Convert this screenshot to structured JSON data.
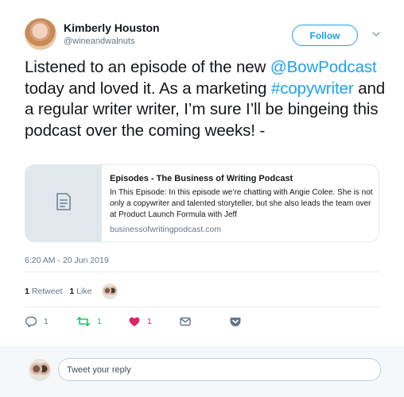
{
  "author": {
    "name": "Kimberly Houston",
    "handle": "@wineandwalnuts",
    "follow_label": "Follow"
  },
  "tweet": {
    "text_1": "Listened to an episode of the new ",
    "mention": "@BowPodcast",
    "text_2": " today and loved it. As a marketing ",
    "hashtag": "#copywriter",
    "text_3": " and a regular writer writer, I’m sure I’ll be bingeing this podcast over the coming weeks! -"
  },
  "card": {
    "title": "Episodes - The Business of Writing Podcast",
    "description": "In This Episode:  In this episode we’re chatting with Angie Colee. She is not only a copywriter and talented storyteller, but she also leads the team over at Product Launch Formula with Jeff",
    "domain": "businessofwritingpodcast.com",
    "thumb_icon": "document-icon"
  },
  "timestamp": "6:20 AM - 20 Jun 2019",
  "stats": {
    "retweets_count": "1",
    "retweets_label": "Retweet",
    "likes_count": "1",
    "likes_label": "Like"
  },
  "actions": {
    "reply_count": "1",
    "retweet_count": "1",
    "like_count": "1"
  },
  "reply": {
    "placeholder": "Tweet your reply"
  },
  "colors": {
    "brand_blue": "#1da1f2",
    "retweet_green": "#17bf63",
    "like_red": "#e0245e",
    "muted_gray": "#657786"
  }
}
